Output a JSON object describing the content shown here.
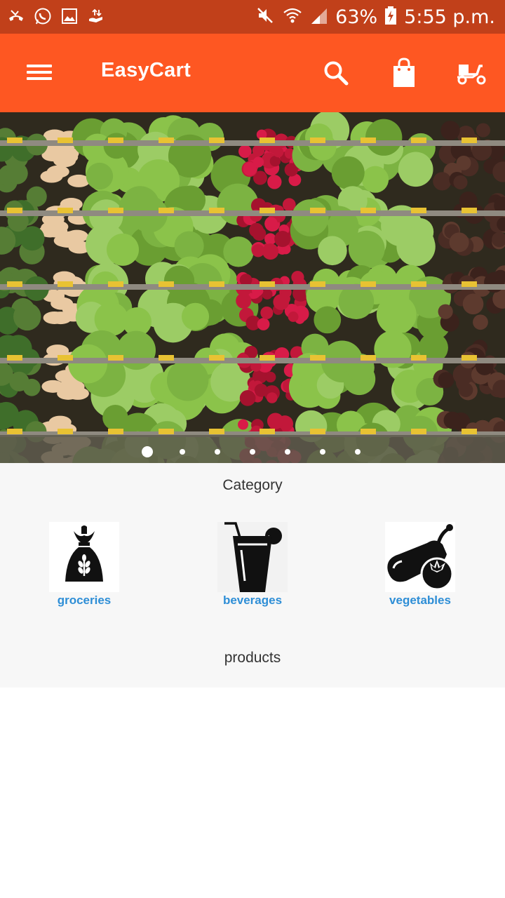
{
  "status_bar": {
    "battery": "63%",
    "time": "5:55 p.m."
  },
  "app_bar": {
    "title": "EasyCart"
  },
  "carousel": {
    "slide_count": 7,
    "active_index": 0
  },
  "categories": {
    "title": "Category",
    "items": [
      {
        "label": "groceries",
        "icon": "grain-bag-icon"
      },
      {
        "label": "beverages",
        "icon": "drink-glass-icon"
      },
      {
        "label": "vegetables",
        "icon": "eggplant-tomato-icon"
      }
    ]
  },
  "products": {
    "title": "products"
  },
  "colors": {
    "status_bar": "#c1401a",
    "app_bar": "#fe5722",
    "category_label": "#2e8ed6",
    "background": "#f7f7f7"
  }
}
